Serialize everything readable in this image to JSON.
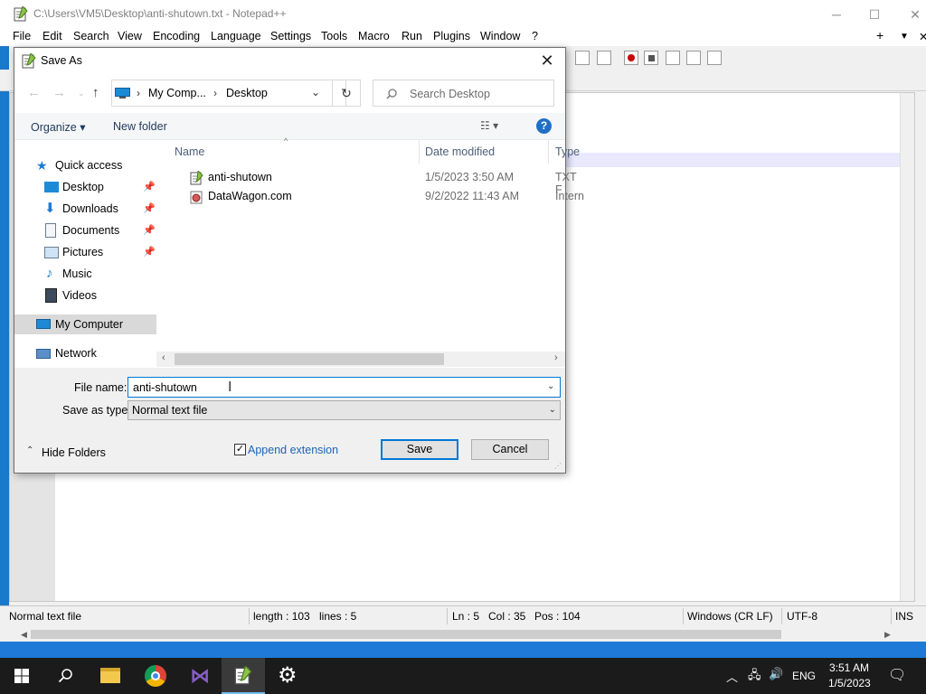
{
  "npp": {
    "title": "C:\\Users\\VM5\\Desktop\\anti-shutown.txt - Notepad++",
    "menu": [
      "File",
      "Edit",
      "Search",
      "View",
      "Encoding",
      "Language",
      "Settings",
      "Tools",
      "Macro",
      "Run",
      "Plugins",
      "Window",
      "?"
    ],
    "menu_right": {
      "plus": "+",
      "down": "▼",
      "close": "✕"
    },
    "status": {
      "type": "Normal text file",
      "length": "length : 103",
      "lines": "lines : 5",
      "ln": "Ln : 5",
      "col": "Col : 35",
      "pos": "Pos : 104",
      "eol": "Windows (CR LF)",
      "encoding": "UTF-8",
      "mode": "INS"
    }
  },
  "dialog": {
    "title": "Save As",
    "breadcrumb": {
      "root": "My Comp...",
      "current": "Desktop"
    },
    "search_placeholder": "Search Desktop",
    "organize": "Organize ▾",
    "new_folder": "New folder",
    "nav": {
      "quick_access": "Quick access",
      "items": [
        "Desktop",
        "Downloads",
        "Documents",
        "Pictures",
        "Music",
        "Videos"
      ],
      "computer": "My Computer",
      "network": "Network"
    },
    "columns": {
      "name": "Name",
      "date": "Date modified",
      "type": "Type"
    },
    "files": [
      {
        "name": "anti-shutown",
        "date": "1/5/2023 3:50 AM",
        "type": "TXT F"
      },
      {
        "name": "DataWagon.com",
        "date": "9/2/2022 11:43 AM",
        "type": "Intern"
      }
    ],
    "file_name_label": "File name:",
    "file_name_value": "anti-shutown",
    "save_as_type_label": "Save as type:",
    "save_as_type_value": "Normal text file",
    "hide_folders": "Hide Folders",
    "append_extension": "Append extension",
    "save": "Save",
    "cancel": "Cancel"
  },
  "taskbar": {
    "lang": "ENG",
    "time": "3:51 AM",
    "date": "1/5/2023"
  }
}
